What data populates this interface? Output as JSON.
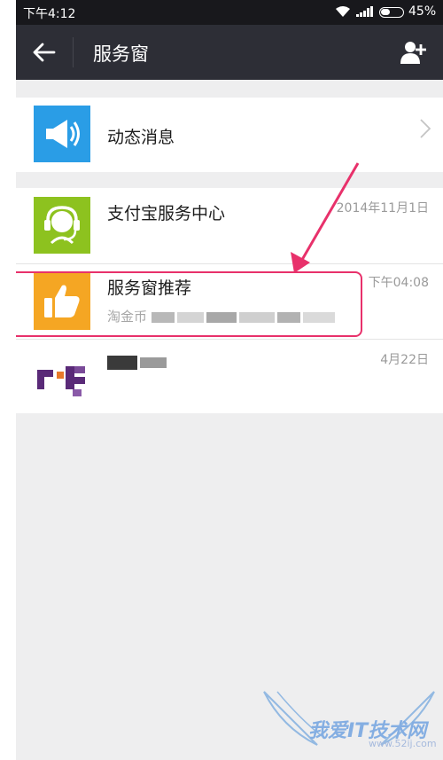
{
  "status_bar": {
    "time": "下午4:12",
    "battery": "45%"
  },
  "header": {
    "title": "服务窗"
  },
  "list": {
    "dynamic_message": {
      "title": "动态消息"
    },
    "alipay_center": {
      "title": "支付宝服务中心",
      "time": "2014年11月1日"
    },
    "recommend": {
      "title": "服务窗推荐",
      "time": "下午04:08",
      "subtitle_prefix": "淘金币"
    },
    "fourth": {
      "time": "4月22日"
    }
  },
  "watermark": {
    "text": "我爱IT技术网",
    "url": "www.52ij.com"
  },
  "colors": {
    "header_bg": "#2d2e36",
    "page_bg": "#eeeeef",
    "icon_blue": "#2a9de6",
    "icon_green": "#8dc21f",
    "icon_orange": "#f5a623",
    "highlight": "#e8316b"
  }
}
